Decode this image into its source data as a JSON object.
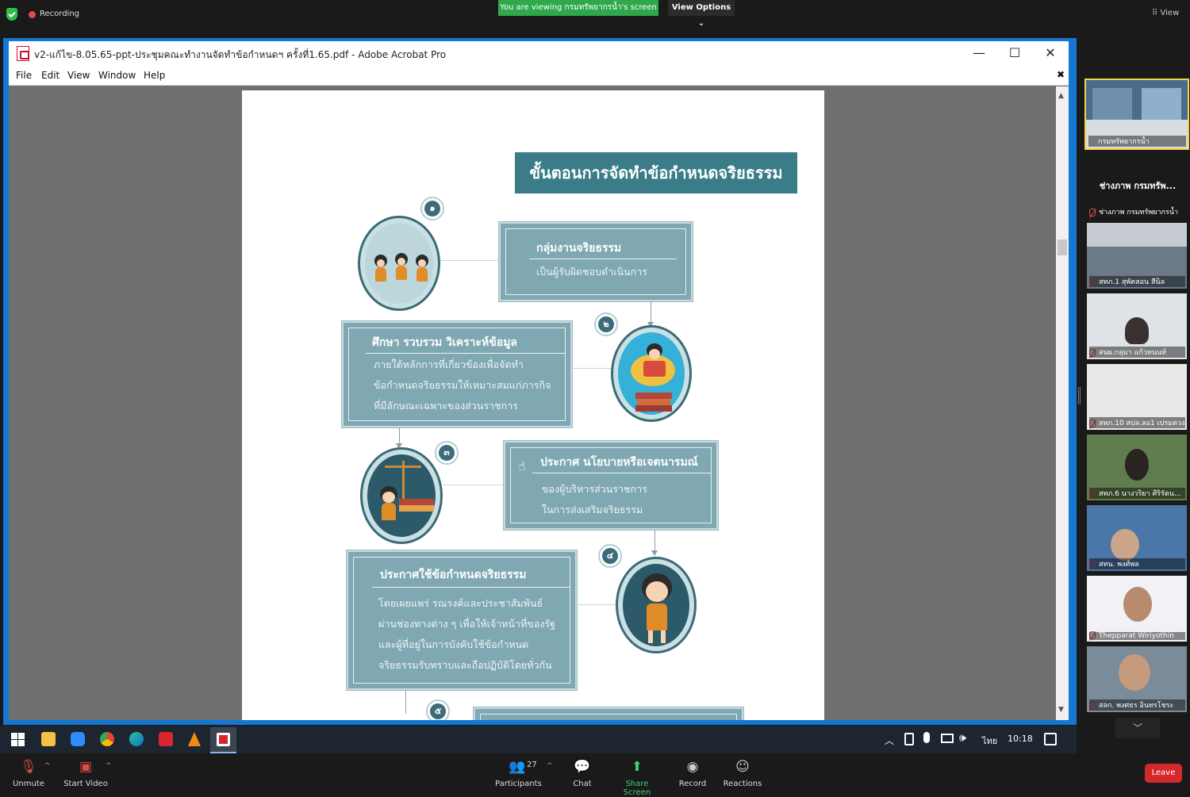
{
  "zoom": {
    "recording_label": "Recording",
    "viewing_banner": "You are viewing กรมทรัพยากรน้ำ's screen",
    "view_options": "View Options ⌄",
    "view_label": "View",
    "toolbar": {
      "unmute": "Unmute",
      "start_video": "Start Video",
      "participants": "Participants",
      "participants_count": "27",
      "chat": "Chat",
      "share_screen": "Share Screen",
      "record": "Record",
      "reactions": "Reactions",
      "leave": "Leave"
    },
    "active_speaker_tile": "กรมทรัพยากรน้ำ",
    "strip_heading": "ช่างภาพ กรมทรัพ...",
    "participants": [
      {
        "name": "ช่างภาพ กรมทรัพยากรน้ำ"
      },
      {
        "name": "สทภ.1 สุพัตสอน สีนิล"
      },
      {
        "name": "สนผ.กลุมา แก้วหนนท์"
      },
      {
        "name": "สทภ.10 สปล.ลอ1 เปรมตวง"
      },
      {
        "name": "สทภ.6 นางวริยา ศิริรัตน..."
      },
      {
        "name": "สทน. พงศ์พล"
      },
      {
        "name": "Thepparat Wiriyothin"
      },
      {
        "name": "สลก. พงศธร อินทรโชระ"
      }
    ]
  },
  "acrobat": {
    "window_title": "v2-แก้ไข-8.05.65-ppt-ประชุมคณะทำงานจัดทำข้อกำหนดฯ ครั้งที่1.65.pdf - Adobe Acrobat Pro",
    "menu": [
      "File",
      "Edit",
      "View",
      "Window",
      "Help"
    ]
  },
  "slide": {
    "title": "ขั้นตอนการจัดทำข้อกำหนดจริยธรรม",
    "steps": [
      {
        "number": "๑",
        "heading": "กลุ่มงานจริยธรรม",
        "lines": [
          "เป็นผู้รับผิดชอบดำเนินการ"
        ]
      },
      {
        "number": "๒",
        "heading": "ศึกษา รวบรวม วิเคราะห์ข้อมูล",
        "lines": [
          "ภายใต้หลักการที่เกี่ยวข้องเพื่อจัดทำ",
          "ข้อกำหนดจริยธรรมให้เหมาะสมแก่ภารกิจ",
          "ที่มีลักษณะเฉพาะของส่วนราชการ"
        ]
      },
      {
        "number": "๓",
        "heading": "ประกาศ นโยบายหรือเจตนารมณ์",
        "lines": [
          "ของผู้บริหารส่วนราชการ",
          "ในการส่งเสริมจริยธรรม"
        ]
      },
      {
        "number": "๔",
        "heading": "ประกาศใช้ข้อกำหนดจริยธรรม",
        "lines": [
          "โดยเผยแพร่ รณรงค์และประชาสัมพันธ์",
          "ผ่านช่องทางต่าง ๆ เพื่อให้เจ้าหน้าที่ของรัฐ",
          "และผู้ที่อยู่ในการบังคับใช้ข้อกำหนด",
          "จริยธรรมรับทราบและถือปฏิบัติโดยทั่วกัน"
        ]
      },
      {
        "number": "๕"
      }
    ]
  },
  "taskbar": {
    "language": "ไทย",
    "time": "10:18"
  }
}
